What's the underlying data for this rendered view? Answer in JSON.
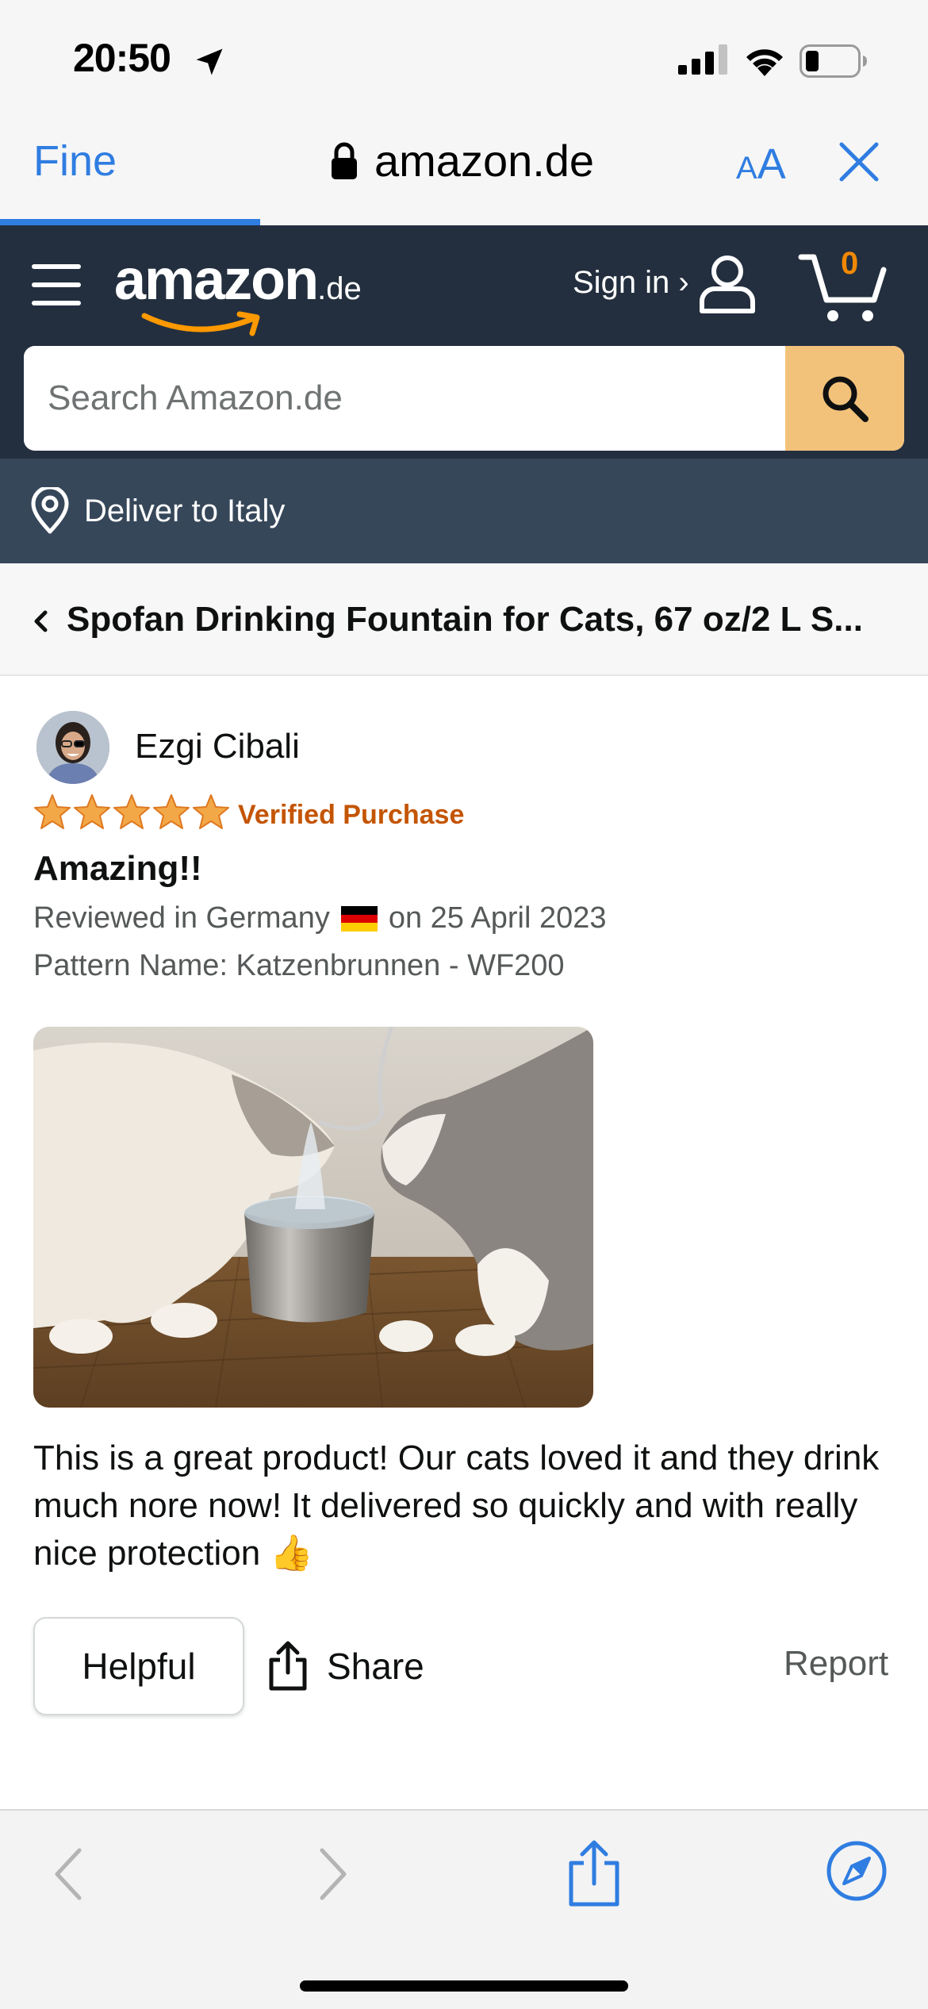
{
  "status_bar": {
    "time": "20:50"
  },
  "browser": {
    "done_label": "Fine",
    "url": "amazon.de",
    "aa_small": "A",
    "aa_big": "A",
    "load_progress": 0.28,
    "accent_color": "#2f7de1"
  },
  "header": {
    "logo_word": "amazon",
    "logo_tld": ".de",
    "signin_label": "Sign in ›",
    "cart_count": "0",
    "background_color": "#232f3e"
  },
  "search": {
    "placeholder": "Search Amazon.de"
  },
  "deliver": {
    "label": "Deliver to Italy"
  },
  "breadcrumb": {
    "title": "Spofan Drinking Fountain for Cats, 67 oz/2 L S..."
  },
  "review": {
    "reviewer_name": "Ezgi Cibali",
    "rating": 5,
    "verified_label": "Verified Purchase",
    "title": "Amazing!!",
    "meta_prefix": "Reviewed in Germany",
    "meta_suffix": "on 25 April 2023",
    "pattern": "Pattern Name: Katzenbrunnen - WF200",
    "body": "This is a great product! Our cats loved it and they drink much nore now! It delivered so quickly and with really nice protection 👍",
    "image_icon": "review-photo-cats-drinking-fountain"
  },
  "actions": {
    "helpful_label": "Helpful",
    "share_label": "Share",
    "report_label": "Report"
  },
  "icons": {
    "location_arrow": "location-arrow-icon",
    "lock": "lock-icon",
    "close": "close-icon",
    "menu": "hamburger-menu-icon",
    "user": "user-icon",
    "cart": "cart-icon",
    "search": "search-icon",
    "pin": "location-pin-icon",
    "chevron": "chevron-left-icon",
    "star": "star-icon",
    "share": "share-icon",
    "back": "back-arrow-icon",
    "forward": "forward-arrow-icon",
    "compass": "compass-icon"
  }
}
